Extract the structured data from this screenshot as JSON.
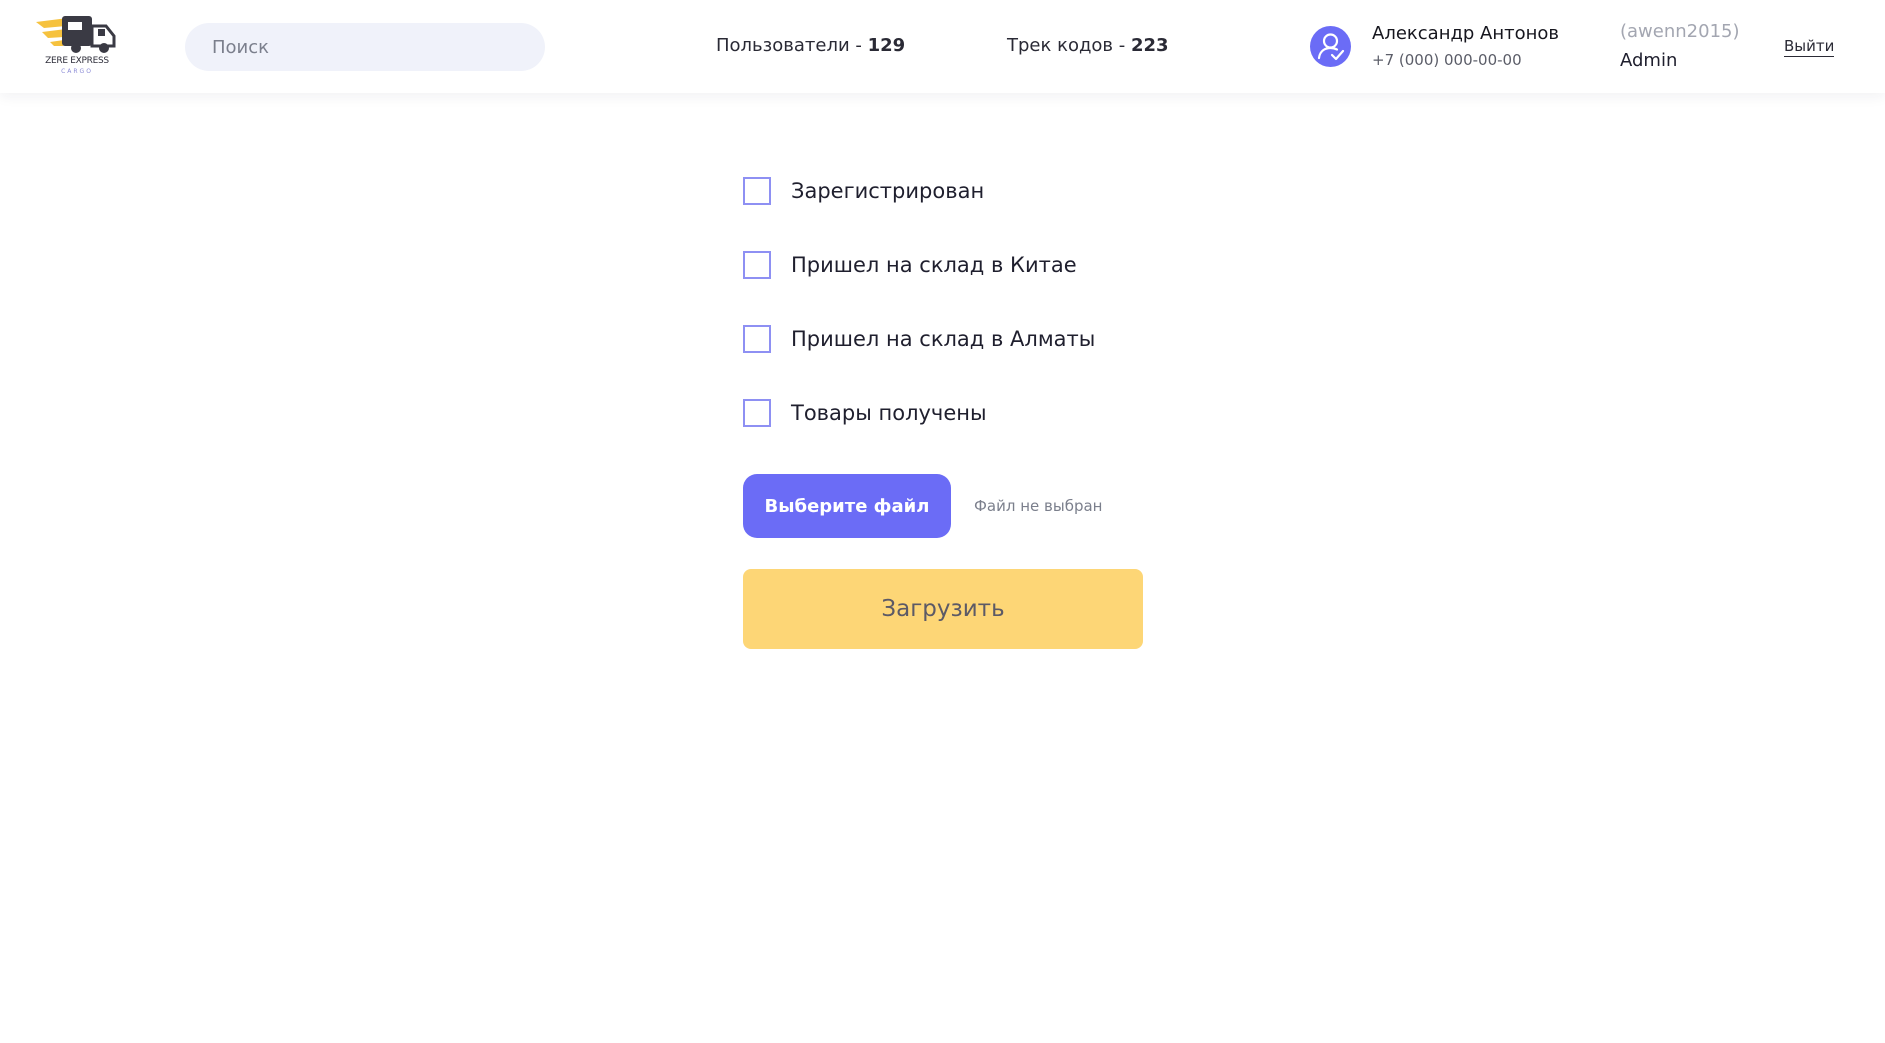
{
  "header": {
    "logo": {
      "name": "ZERE EXPRESS",
      "sub": "CARGO",
      "icon": "truck-logo",
      "accent": "#f6c23e"
    },
    "search": {
      "placeholder": "Поиск",
      "value": ""
    },
    "stats": {
      "users_label": "Пользователи - ",
      "users_count": "129",
      "tracks_label": "Трек кодов - ",
      "tracks_count": "223"
    },
    "user": {
      "avatar_icon": "user-check-icon",
      "name": "Александр Антонов",
      "phone": "+7 (000) 000-00-00",
      "login": "(awenn2015)",
      "role": "Admin"
    },
    "logout_label": "Выйти"
  },
  "form": {
    "statuses": [
      {
        "label": "Зарегистрирован",
        "checked": false
      },
      {
        "label": "Пришел на склад в Китае",
        "checked": false
      },
      {
        "label": "Пришел на склад в Алматы",
        "checked": false
      },
      {
        "label": "Товары получены",
        "checked": false
      }
    ],
    "file_button_label": "Выберите файл",
    "file_status": "Файл не выбран",
    "upload_label": "Загрузить"
  },
  "colors": {
    "primary": "#6b6cf6",
    "checkbox_border": "#8e90f3",
    "upload": "#fdd676",
    "search_bg": "#f0f2fa"
  }
}
